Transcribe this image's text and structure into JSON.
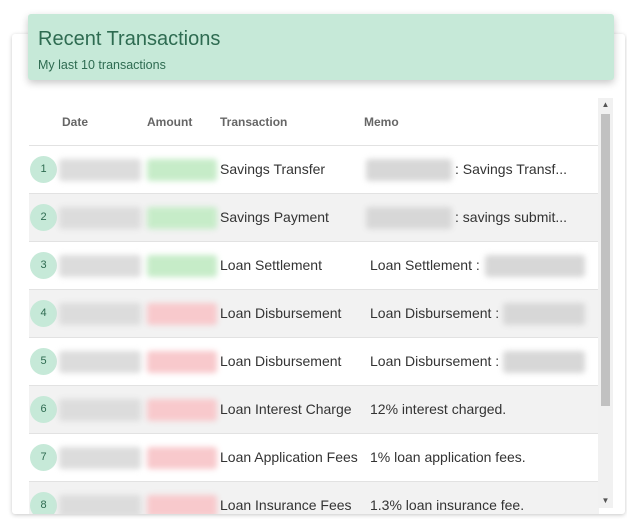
{
  "header": {
    "title": "Recent Transactions",
    "subtitle": "My last 10 transactions"
  },
  "table": {
    "columns": [
      "Date",
      "Amount",
      "Transaction",
      "Memo"
    ],
    "rows": [
      {
        "index": "1",
        "transaction": "Savings Transfer",
        "memo": ": Savings Transf...",
        "amount_color": "green"
      },
      {
        "index": "2",
        "transaction": "Savings Payment",
        "memo": ": savings submit...",
        "amount_color": "green"
      },
      {
        "index": "3",
        "transaction": "Loan Settlement",
        "memo": "Loan Settlement :",
        "amount_color": "green"
      },
      {
        "index": "4",
        "transaction": "Loan Disbursement",
        "memo": "Loan Disbursement :",
        "amount_color": "red"
      },
      {
        "index": "5",
        "transaction": "Loan Disbursement",
        "memo": "Loan Disbursement :",
        "amount_color": "red"
      },
      {
        "index": "6",
        "transaction": "Loan Interest Charge",
        "memo": "12% interest charged.",
        "amount_color": "red"
      },
      {
        "index": "7",
        "transaction": "Loan Application Fees",
        "memo": "1% loan application fees.",
        "amount_color": "red"
      },
      {
        "index": "8",
        "transaction": "Loan Insurance Fees",
        "memo": "1.3% loan insurance fee.",
        "amount_color": "red"
      }
    ]
  },
  "colors": {
    "accent": "#c6e9d8",
    "accent_text": "#2e6b51",
    "positive": "#c6ecc8",
    "negative": "#f8c9cc"
  },
  "scrollbar": {
    "up_icon": "triangle-up-icon",
    "down_icon": "triangle-down-icon"
  }
}
